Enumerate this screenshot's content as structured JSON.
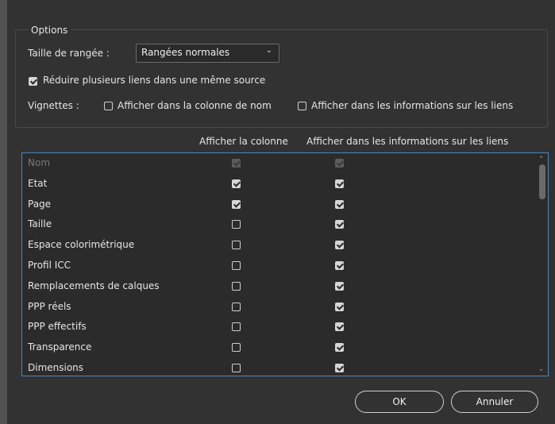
{
  "options": {
    "legend": "Options",
    "row_size_label": "Taille de rangée :",
    "row_size_value": "Rangées normales",
    "collapse_links_label": "Réduire plusieurs liens dans une même source",
    "collapse_links_checked": true,
    "thumbnails_label": "Vignettes :",
    "thumb_name_label": "Afficher dans la colonne de nom",
    "thumb_name_checked": false,
    "thumb_info_label": "Afficher dans les informations sur les liens",
    "thumb_info_checked": false
  },
  "table": {
    "col_show_column": "Afficher la colonne",
    "col_show_info": "Afficher dans les informations sur les liens",
    "rows": [
      {
        "name": "Nom",
        "col": true,
        "info": true,
        "disabled": true
      },
      {
        "name": "Etat",
        "col": true,
        "info": true
      },
      {
        "name": "Page",
        "col": true,
        "info": true
      },
      {
        "name": "Taille",
        "col": false,
        "info": true
      },
      {
        "name": "Espace colorimétrique",
        "col": false,
        "info": true
      },
      {
        "name": "Profil ICC",
        "col": false,
        "info": true
      },
      {
        "name": "Remplacements de calques",
        "col": false,
        "info": true
      },
      {
        "name": "PPP réels",
        "col": false,
        "info": true
      },
      {
        "name": "PPP effectifs",
        "col": false,
        "info": true
      },
      {
        "name": "Transparence",
        "col": false,
        "info": true
      },
      {
        "name": "Dimensions",
        "col": false,
        "info": true
      }
    ]
  },
  "buttons": {
    "ok": "OK",
    "cancel": "Annuler"
  },
  "icons": {
    "dropdown": "chevron-down-icon",
    "scroll_up": "caret-up-icon",
    "scroll_down": "caret-down-icon"
  }
}
